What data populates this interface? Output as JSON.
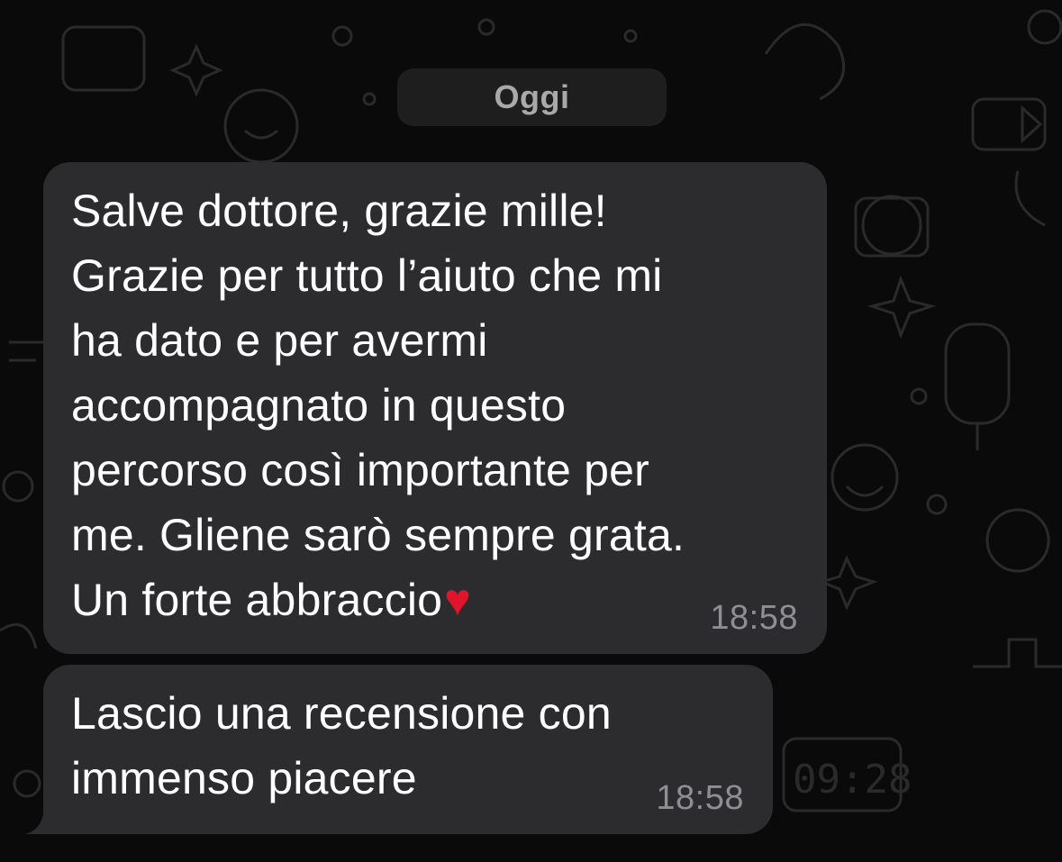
{
  "date_separator": "Oggi",
  "messages": [
    {
      "text": "Salve dottore, grazie mille!\nGrazie per tutto l’aiuto che mi\nha dato e per avermi\naccompagnato in questo\npercorso così importante per\nme. Gliene sarò sempre grata.\nUn forte abbraccio",
      "emoji": "♥",
      "time": "18:58"
    },
    {
      "text": "Lascio una recensione con\nimmenso piacere",
      "time": "18:58"
    }
  ],
  "wallpaper_clock": "09:28",
  "colors": {
    "background": "#0a0a0a",
    "bubble": "#2c2c2e",
    "text": "#ffffff",
    "timestamp": "#8e8e93",
    "date_pill": "#1e1e1e",
    "heart": "#e0152b"
  }
}
